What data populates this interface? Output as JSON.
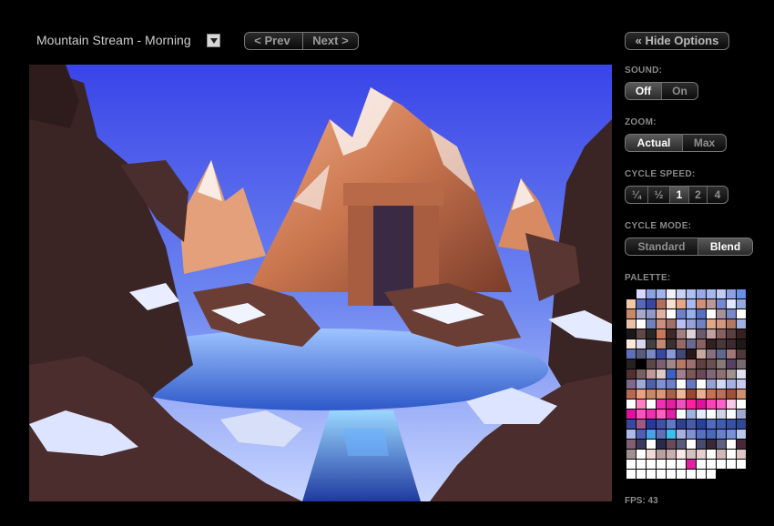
{
  "header": {
    "scene_title": "Mountain Stream - Morning",
    "prev_label": "< Prev",
    "next_label": "Next >",
    "hide_options_label": "« Hide Options"
  },
  "options": {
    "sound": {
      "label": "SOUND:",
      "options": [
        "Off",
        "On"
      ],
      "selected": "Off"
    },
    "zoom": {
      "label": "ZOOM:",
      "options": [
        "Actual",
        "Max"
      ],
      "selected": "Actual"
    },
    "cycle_speed": {
      "label": "CYCLE SPEED:",
      "options": [
        "¼",
        "½",
        "1",
        "2",
        "4"
      ],
      "selected": "1"
    },
    "cycle_mode": {
      "label": "CYCLE MODE:",
      "options": [
        "Standard",
        "Blend"
      ],
      "selected": "Blend"
    },
    "palette_label": "PALETTE:"
  },
  "palette_colors": [
    "#000000",
    "#d8d8ff",
    "#8aa0e0",
    "#a0b4ec",
    "#f0f0ff",
    "#c8d0f4",
    "#b0c0f0",
    "#98a8e8",
    "#a8b8ec",
    "#c0ccf4",
    "#90a0e4",
    "#6890e8",
    "#f2c8a8",
    "#5868b8",
    "#3848a0",
    "#b07060",
    "#f8e0d0",
    "#e8a888",
    "#a8b8f0",
    "#d09078",
    "#b89898",
    "#7888d0",
    "#e0e8ff",
    "#98a8e0",
    "#c88868",
    "#a8a8c8",
    "#9098c8",
    "#e0b0a0",
    "#ffffff",
    "#7080c8",
    "#98b0e8",
    "#5870c0",
    "#ffffff",
    "#a89098",
    "#7888c8",
    "#ffffff",
    "#e8c0a8",
    "#ffffff",
    "#7080b8",
    "#c89080",
    "#a07068",
    "#b8c0f0",
    "#98a0d8",
    "#7080c0",
    "#e0a888",
    "#d09880",
    "#b07860",
    "#a0b0e0",
    "#181818",
    "#604848",
    "#282828",
    "#c87858",
    "#402828",
    "#a08080",
    "#e0d0d8",
    "#6a5a6a",
    "#c0a0a0",
    "#886060",
    "#5a4040",
    "#382020",
    "#ffe8d8",
    "#d8d8f0",
    "#404040",
    "#c08878",
    "#3a3030",
    "#986868",
    "#6a6a90",
    "#8a6060",
    "#302020",
    "#4a3838",
    "#402830",
    "#201818",
    "#6070b8",
    "#5a5a7a",
    "#7888c0",
    "#3848a0",
    "#8898d8",
    "#404878",
    "#281818",
    "#c8a8a0",
    "#887080",
    "#606890",
    "#a07878",
    "#503838",
    "#282020",
    "#000000",
    "#5a4848",
    "#7a6070",
    "#a08888",
    "#b87868",
    "#9a7070",
    "#604040",
    "#6a5050",
    "#887878",
    "#584060",
    "#786870",
    "#503030",
    "#786060",
    "#c09898",
    "#e0c8c8",
    "#4060c0",
    "#a08090",
    "#7a5858",
    "#6a4858",
    "#806878",
    "#907070",
    "#a09090",
    "#e0e0f0",
    "#806888",
    "#a0a8d8",
    "#5060a8",
    "#8090d0",
    "#7080c8",
    "#ffffff",
    "#6878c0",
    "#ffffff",
    "#98a0d0",
    "#d0d8f4",
    "#a8b0e0",
    "#c8c8f0",
    "#b86850",
    "#e8a080",
    "#c88868",
    "#d89878",
    "#a86048",
    "#f0b898",
    "#984830",
    "#e8b090",
    "#c87050",
    "#b87058",
    "#a05038",
    "#d09070",
    "#ffffff",
    "#ff80c0",
    "#ffffff",
    "#f030b0",
    "#e020a0",
    "#f050c0",
    "#ff20a0",
    "#e010a0",
    "#ff40b8",
    "#ff60c8",
    "#f8c8e8",
    "#ffffff",
    "#e010a0",
    "#ff50c0",
    "#f030b0",
    "#ff60c0",
    "#e020a8",
    "#ffffff",
    "#a0b0e0",
    "#e8e8ff",
    "#ffffff",
    "#d0d0e8",
    "#ffffff",
    "#a0a8d0",
    "#3848a0",
    "#a05888",
    "#2838a0",
    "#4050a8",
    "#6078c8",
    "#304090",
    "#485aa8",
    "#2840a0",
    "#506ac0",
    "#405cb0",
    "#3850a8",
    "#304898",
    "#b0b8e8",
    "#5060b0",
    "#48a0e8",
    "#6070b8",
    "#38c0f0",
    "#a8b0e0",
    "#8090d0",
    "#5870c0",
    "#4868b8",
    "#6880c8",
    "#7890d8",
    "#b8c8f0",
    "#806070",
    "#3a3a5a",
    "#ffffff",
    "#2a2a4a",
    "#6a4a5a",
    "#5a5a7a",
    "#ffffff",
    "#4a4a6a",
    "#382838",
    "#606080",
    "#ffffff",
    "#482838",
    "#a09090",
    "#ffffff",
    "#f0d8d8",
    "#b8a0a0",
    "#c8b0b0",
    "#f8e8e8",
    "#d8c0c0",
    "#e8d0d0",
    "#ffffff",
    "#d0b8b8",
    "#ffffff",
    "#e0c8c8",
    "#ffffff",
    "#ffffff",
    "#ffffff",
    "#ffffff",
    "#ffffff",
    "#ffffff",
    "#e020a0",
    "#ffffff",
    "#ffffff",
    "#ffffff",
    "#ffffff",
    "#ffffff",
    "#ffffff",
    "#ffffff",
    "#ffffff",
    "#ffffff",
    "#ffffff",
    "#ffffff",
    "#ffffff",
    "#ffffff",
    "#ffffff",
    "#000000",
    "#000000",
    "#000000"
  ],
  "fps_text": "FPS: 43"
}
